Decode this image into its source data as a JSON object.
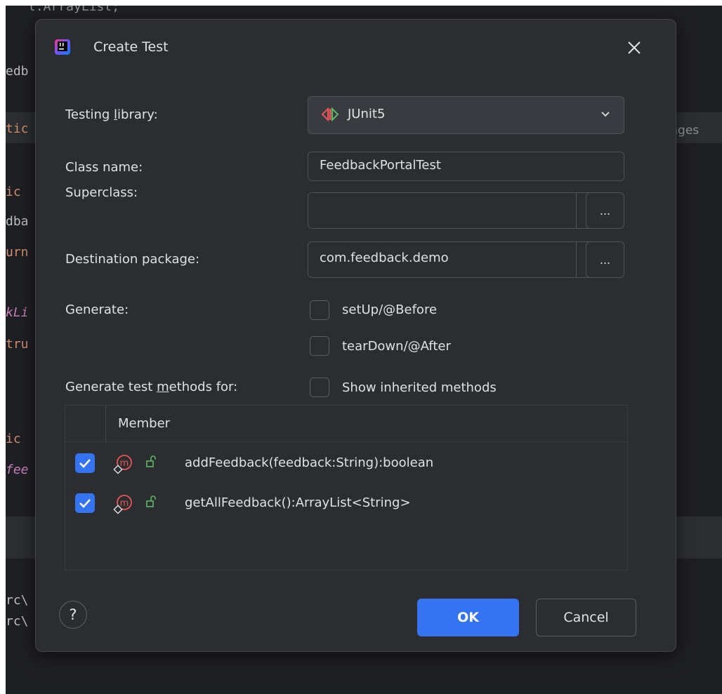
{
  "background_code": {
    "line1": "t.ArrayList;",
    "line2": "edb",
    "line3": "tic",
    "line4": "ic",
    "line5": "dba",
    "line6": "urn",
    "line7": "kLi",
    "line8": "tru",
    "line9": "ic",
    "line10": "fee",
    "line11": "rc\\",
    "line12": "rc\\",
    "usages": "usages"
  },
  "dialog": {
    "title": "Create Test",
    "close_icon": "close-icon",
    "testing_library": {
      "label_pre": "Testing ",
      "label_u": "l",
      "label_post": "ibrary:",
      "value": "JUnit5"
    },
    "class_name": {
      "label": "Class name:",
      "value": "FeedbackPortalTest"
    },
    "superclass": {
      "label": "Superclass:",
      "value": "",
      "browse": "..."
    },
    "destination_package": {
      "label": "Destination package:",
      "value": "com.feedback.demo",
      "browse": "..."
    },
    "generate": {
      "label": "Generate:",
      "setup": {
        "label": "setUp/@Before",
        "checked": false
      },
      "teardown": {
        "label": "tearDown/@After",
        "checked": false
      }
    },
    "methods_for": {
      "label_pre": "Generate test ",
      "label_u": "m",
      "label_post": "ethods for:",
      "show_inherited": {
        "label": "Show inherited methods",
        "checked": false
      }
    },
    "table": {
      "column": "Member",
      "rows": [
        {
          "checked": true,
          "signature": "addFeedback(feedback:String):boolean"
        },
        {
          "checked": true,
          "signature": "getAllFeedback():ArrayList<String>"
        }
      ]
    },
    "buttons": {
      "help": "?",
      "ok": "OK",
      "cancel": "Cancel"
    }
  },
  "colors": {
    "accent": "#3574f0",
    "dialog_bg": "#2b2d30",
    "editor_bg": "#1e1f22",
    "method_icon": "#e55757",
    "lock_icon": "#5fb865"
  }
}
